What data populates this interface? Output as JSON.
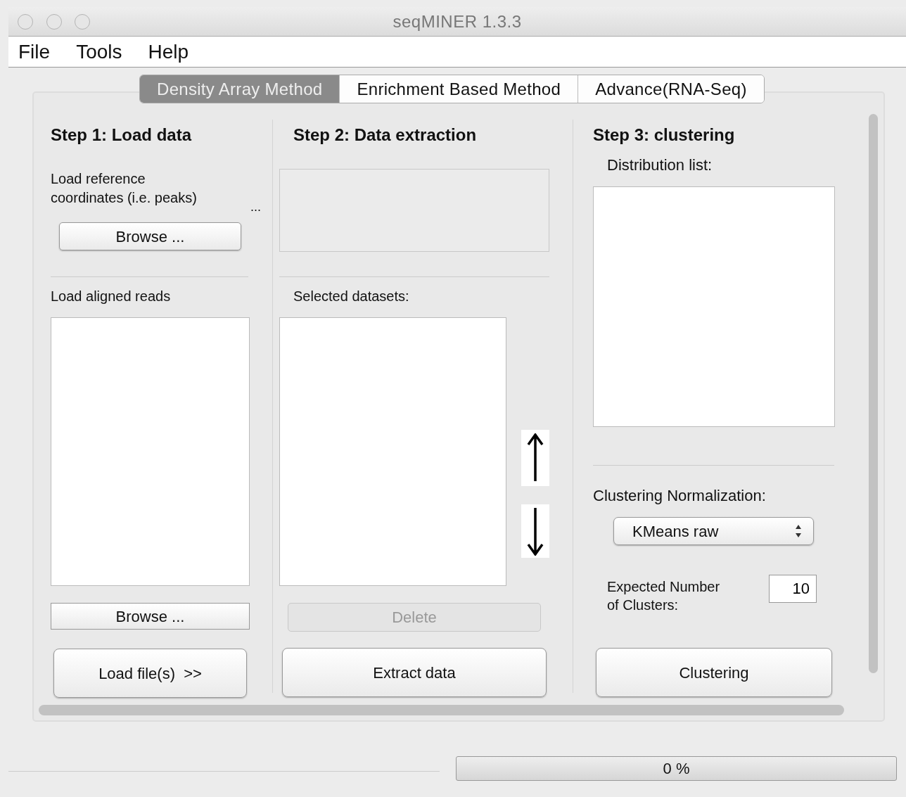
{
  "window": {
    "title": "seqMINER 1.3.3"
  },
  "menu": [
    {
      "label": "File"
    },
    {
      "label": "Tools"
    },
    {
      "label": "Help"
    }
  ],
  "tabs": [
    {
      "label": "Density Array Method",
      "selected": true
    },
    {
      "label": "Enrichment Based Method",
      "selected": false
    },
    {
      "label": "Advance(RNA-Seq)",
      "selected": false
    }
  ],
  "step1": {
    "title": "Step 1: Load data",
    "reference_label": "Load reference coordinates (i.e. peaks)",
    "reference_more": "...",
    "reference_browse": "Browse ...",
    "reads_label": "Load aligned reads",
    "reads_browse": "Browse ...",
    "load_button": "Load file(s)  >>"
  },
  "step2": {
    "title": "Step 2: Data extraction",
    "selected_label": "Selected datasets:",
    "delete_button": {
      "label": "Delete",
      "disabled": true
    },
    "extract_button": "Extract data"
  },
  "step3": {
    "title": "Step 3: clustering",
    "distribution_label": "Distribution list:",
    "normalization_label": "Clustering Normalization:",
    "normalization_select": {
      "value": "KMeans raw"
    },
    "clusters_label": "Expected Number of Clusters:",
    "clusters_input": {
      "value": "10"
    },
    "clustering_button": "Clustering"
  },
  "progress": {
    "level": 0,
    "label": "0 %"
  }
}
